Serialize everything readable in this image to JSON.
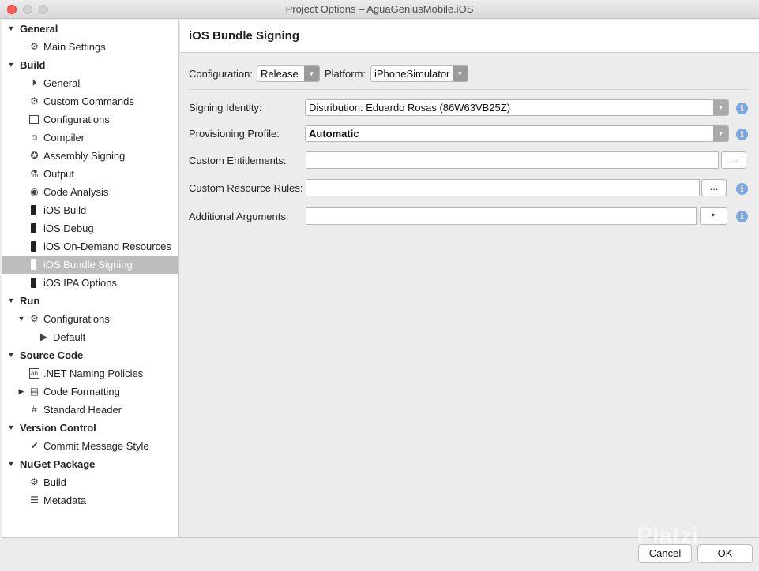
{
  "window": {
    "title": "Project Options – AguaGeniusMobile.iOS"
  },
  "sidebar": {
    "items": [
      {
        "label": "General",
        "name": "tree-category-general",
        "type": "cat",
        "icon": "",
        "expanded": true
      },
      {
        "label": "Main Settings",
        "name": "tree-item-main-settings",
        "type": "item",
        "icon": "gear-icon"
      },
      {
        "label": "Build",
        "name": "tree-category-build",
        "type": "cat",
        "icon": "",
        "expanded": true
      },
      {
        "label": "General",
        "name": "tree-item-build-general",
        "type": "item",
        "icon": "play-bar-icon"
      },
      {
        "label": "Custom Commands",
        "name": "tree-item-custom-commands",
        "type": "item",
        "icon": "gear-icon"
      },
      {
        "label": "Configurations",
        "name": "tree-item-configurations",
        "type": "item",
        "icon": "window-icon"
      },
      {
        "label": "Compiler",
        "name": "tree-item-compiler",
        "type": "item",
        "icon": "compiler-icon"
      },
      {
        "label": "Assembly Signing",
        "name": "tree-item-assembly-signing",
        "type": "item",
        "icon": "seal-icon"
      },
      {
        "label": "Output",
        "name": "tree-item-output",
        "type": "item",
        "icon": "flask-icon"
      },
      {
        "label": "Code Analysis",
        "name": "tree-item-code-analysis",
        "type": "item",
        "icon": "target-icon"
      },
      {
        "label": "iOS Build",
        "name": "tree-item-ios-build",
        "type": "item",
        "icon": "phone-icon"
      },
      {
        "label": "iOS Debug",
        "name": "tree-item-ios-debug",
        "type": "item",
        "icon": "phone-icon"
      },
      {
        "label": "iOS On-Demand Resources",
        "name": "tree-item-ios-on-demand-resources",
        "type": "item",
        "icon": "phone-icon"
      },
      {
        "label": "iOS Bundle Signing",
        "name": "tree-item-ios-bundle-signing",
        "type": "item",
        "icon": "phone-icon",
        "selected": true
      },
      {
        "label": "iOS IPA Options",
        "name": "tree-item-ios-ipa-options",
        "type": "item",
        "icon": "phone-icon"
      },
      {
        "label": "Run",
        "name": "tree-category-run",
        "type": "cat",
        "icon": "",
        "expanded": true
      },
      {
        "label": "Configurations",
        "name": "tree-item-run-configurations",
        "type": "item",
        "icon": "gear-icon",
        "twisty": "down"
      },
      {
        "label": "Default",
        "name": "tree-item-default",
        "type": "sub",
        "icon": "play-icon"
      },
      {
        "label": "Source Code",
        "name": "tree-category-source-code",
        "type": "cat",
        "icon": "",
        "expanded": true
      },
      {
        "label": ".NET Naming Policies",
        "name": "tree-item-naming-policies",
        "type": "item",
        "icon": "ab-icon"
      },
      {
        "label": "Code Formatting",
        "name": "tree-item-code-formatting",
        "type": "item",
        "icon": "document-icon",
        "twisty": "right"
      },
      {
        "label": "Standard Header",
        "name": "tree-item-standard-header",
        "type": "item",
        "icon": "hash-icon"
      },
      {
        "label": "Version Control",
        "name": "tree-category-version-control",
        "type": "cat",
        "icon": "",
        "expanded": true
      },
      {
        "label": "Commit Message Style",
        "name": "tree-item-commit-message-style",
        "type": "item",
        "icon": "check-circle-icon"
      },
      {
        "label": "NuGet Package",
        "name": "tree-category-nuget-package",
        "type": "cat",
        "icon": "",
        "expanded": true
      },
      {
        "label": "Build",
        "name": "tree-item-nuget-build",
        "type": "item",
        "icon": "gear-icon"
      },
      {
        "label": "Metadata",
        "name": "tree-item-metadata",
        "type": "item",
        "icon": "list-icon"
      }
    ]
  },
  "panel": {
    "title": "iOS Bundle Signing",
    "configuration_label": "Configuration:",
    "configuration_value": "Release",
    "platform_label": "Platform:",
    "platform_value": "iPhoneSimulator",
    "signing_identity_label": "Signing Identity:",
    "signing_identity_value": "Distribution: Eduardo Rosas (86W63VB25Z)",
    "provisioning_profile_label": "Provisioning Profile:",
    "provisioning_profile_value": "Automatic",
    "custom_entitlements_label": "Custom Entitlements:",
    "custom_entitlements_value": "",
    "custom_resource_rules_label": "Custom Resource Rules:",
    "custom_resource_rules_value": "",
    "additional_arguments_label": "Additional Arguments:",
    "additional_arguments_value": "",
    "browse_label": "...",
    "run_label": "▸"
  },
  "buttons": {
    "cancel": "Cancel",
    "ok": "OK"
  },
  "watermark": "Platzi"
}
